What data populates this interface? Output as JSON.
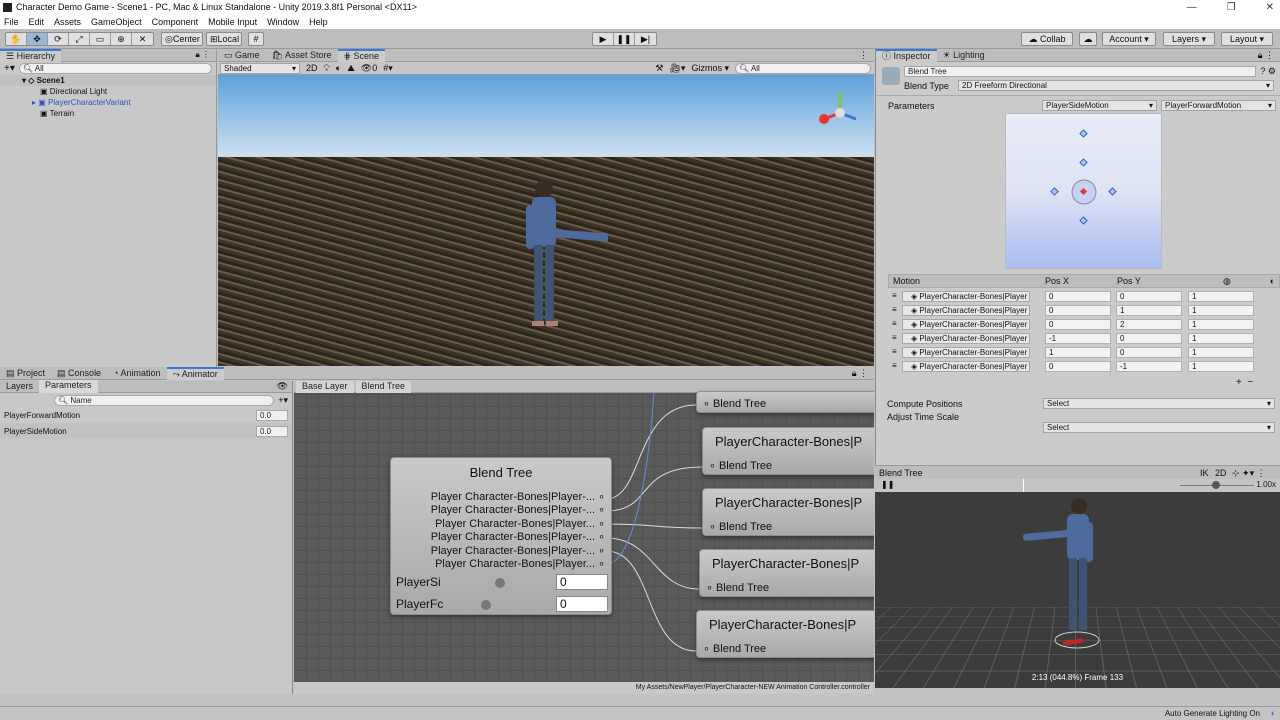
{
  "window": {
    "title": "Character Demo Game - Scene1 - PC, Mac & Linux Standalone - Unity 2019.3.8f1 Personal <DX11>",
    "controls": [
      "—",
      "❐",
      "✕"
    ]
  },
  "menu": [
    "File",
    "Edit",
    "Assets",
    "GameObject",
    "Component",
    "Mobile Input",
    "Window",
    "Help"
  ],
  "toolbar": {
    "center": "Center",
    "local": "Local",
    "collab": "Collab",
    "account": "Account",
    "layers": "Layers",
    "layout": "Layout"
  },
  "hierarchy": {
    "tab": "Hierarchy",
    "search": "All",
    "scene": "Scene1",
    "items": [
      "Directional Light",
      "PlayerCharacterVariant",
      "Terrain"
    ]
  },
  "scene": {
    "tabs": [
      "Game",
      "Asset Store",
      "Scene"
    ],
    "shading": "Shaded",
    "mode2d": "2D",
    "gizmos": "Gizmos",
    "search": "All",
    "hidden_count": "0"
  },
  "bottom_tabs": [
    "Project",
    "Console",
    "Animation",
    "Animator"
  ],
  "animator": {
    "subtabs": [
      "Layers",
      "Parameters"
    ],
    "search": "Name",
    "params": [
      {
        "name": "PlayerForwardMotion",
        "value": "0.0"
      },
      {
        "name": "PlayerSideMotion",
        "value": "0.0"
      }
    ],
    "breadcrumb": [
      "Base Layer",
      "Blend Tree"
    ],
    "node_title": "Blend Tree",
    "node_motions": [
      "Player Character-Bones|Player-...",
      "Player Character-Bones|Player-...",
      "Player Character-Bones|Player...",
      "Player Character-Bones|Player-...",
      "Player Character-Bones|Player-...",
      "Player Character-Bones|Player..."
    ],
    "node_params": [
      {
        "label": "PlayerSi",
        "value": "0"
      },
      {
        "label": "PlayerFc",
        "value": "0"
      }
    ],
    "child_title": "PlayerCharacter-Bones|P",
    "child_label": "Blend Tree",
    "top_child_label": "Blend Tree",
    "path": "My Assets/NewPlayer/PlayerCharacter-NEW Animation Controller.controller"
  },
  "inspector": {
    "tabs": [
      "Inspector",
      "Lighting"
    ],
    "name": "Blend Tree",
    "blend_type_label": "Blend Type",
    "blend_type": "2D Freeform Directional",
    "parameters_label": "Parameters",
    "param_x": "PlayerSideMotion",
    "param_y": "PlayerForwardMotion",
    "headers": [
      "Motion",
      "Pos X",
      "Pos Y"
    ],
    "motions": [
      {
        "clip": "PlayerCharacter-Bones|Player",
        "x": "0",
        "y": "0",
        "speed": "1"
      },
      {
        "clip": "PlayerCharacter-Bones|Player",
        "x": "0",
        "y": "1",
        "speed": "1"
      },
      {
        "clip": "PlayerCharacter-Bones|Player",
        "x": "0",
        "y": "2",
        "speed": "1"
      },
      {
        "clip": "PlayerCharacter-Bones|Player",
        "x": "-1",
        "y": "0",
        "speed": "1"
      },
      {
        "clip": "PlayerCharacter-Bones|Player",
        "x": "1",
        "y": "0",
        "speed": "1"
      },
      {
        "clip": "PlayerCharacter-Bones|Player",
        "x": "0",
        "y": "-1",
        "speed": "1"
      }
    ],
    "compute_label": "Compute Positions",
    "compute_value": "Select",
    "adjust_label": "Adjust Time Scale",
    "adjust_value": "Select"
  },
  "preview": {
    "title": "Blend Tree",
    "ik": "IK",
    "mode2d": "2D",
    "speed": "1.00x",
    "status": "2:13 (044.8%) Frame 133"
  },
  "status": {
    "lighting": "Auto Generate Lighting On"
  },
  "colors": {
    "accent": "#3a79d8",
    "sky_top": "#5ea0dc",
    "preview_bg": "#3c3c3c"
  }
}
